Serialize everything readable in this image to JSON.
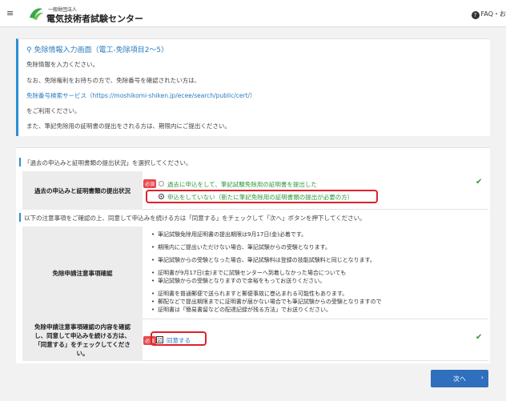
{
  "header": {
    "menu_icon": "hamburger-icon",
    "org_small": "一般財団法人",
    "org_name": "電気技術者試験センター",
    "faq_label": "FAQ・お"
  },
  "info": {
    "title": "免除情報入力画面（電工-免除項目2～5）",
    "line1": "免除情報を入力ください。",
    "line2": "なお、免除権利をお持ちの方で、免除番号を確認されたい方は、",
    "link": "免除番号検索サービス（https://moshikomi-shiken.jp/ecee/search/public/cert/）",
    "line3": "をご利用ください。",
    "line4": "また、筆記免除用の証明書の提出をされる方は、期限内にご提出ください。"
  },
  "status": {
    "instruction": "「過去の申込みと証明書類の提出状況」を選択してください。",
    "label": "過去の申込みと証明書類の提出状況",
    "required": "必須",
    "option1": "過去に申込をして、筆記試験免除用の証明書を提出した",
    "option2": "申込をしていない（新たに筆記免除用の証明書類の提出が必要の方）",
    "selected": "option2"
  },
  "notes": {
    "instruction": "以下の注意事項をご確認の上、同意して申込みを続ける方は「同意する」をチェックして「次へ」ボタンを押下してください。",
    "label": "免除申請注意事項確認",
    "items": [
      "筆記試験免除用証明書の提出期限は9月17日(金)必着です。",
      "期限内にご提出いただけない場合、筆記試験からの受験となります。",
      "筆記試験からの受験となった場合、筆記試験料は登録の技能試験料と同じとなります。",
      "証明書が9月17日(金)までに試験センターへ到着しなかった場合についても",
      "筆記試験からの受験となりますので余裕をもってお送りください。",
      "証明書を普通郵便で送られますと郵便事故に巻込まれる可能性もあります。",
      "郵配などで提出期限までに証明書が届かない場合でも筆記試験からの受験となりますので",
      "証明書は「簡易書留などの配達記録が残る方法」でお送りください。"
    ]
  },
  "agree": {
    "label_line1": "免除申請注意事項確認の内容を確認",
    "label_line2": "し、同意して申込みを続ける方は、",
    "label_line3": "「同意する」をチェックしてくださ",
    "label_line4": "い。",
    "required": "必須",
    "checkbox_label": "同意する",
    "checked": "☑"
  },
  "buttons": {
    "next": "次へ",
    "next_chevron": "›"
  },
  "colors": {
    "accent": "#2b8fd4",
    "button": "#2f6fbd",
    "highlight": "#e0202a",
    "success": "#2a9a3a"
  }
}
